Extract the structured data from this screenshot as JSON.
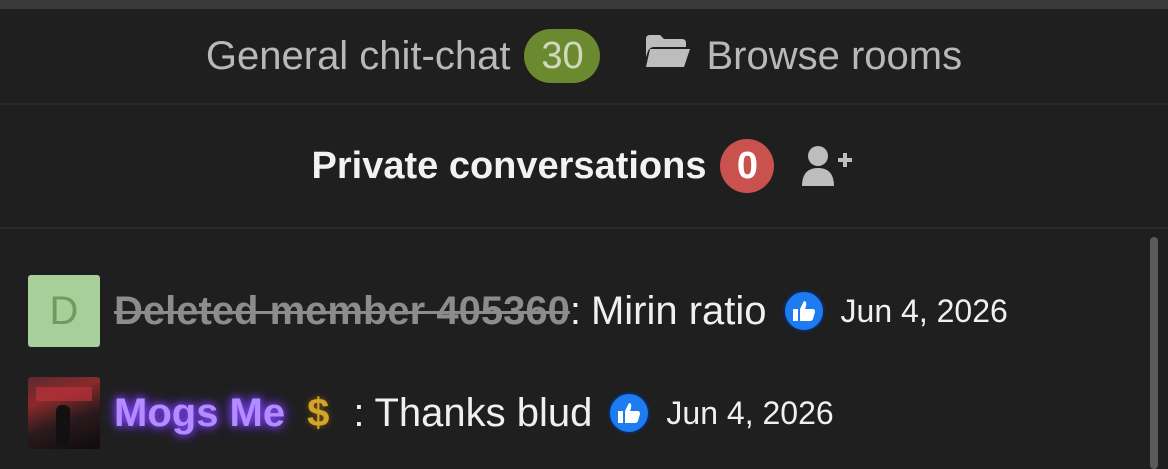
{
  "rooms": {
    "general_label": "General chit-chat",
    "general_count": "30",
    "browse_label": "Browse rooms"
  },
  "private": {
    "label": "Private conversations",
    "count": "0"
  },
  "messages": [
    {
      "avatar_letter": "D",
      "author": "Deleted member 405360",
      "separator": ":",
      "text": "Mirin ratio",
      "date": "Jun 4, 2026"
    },
    {
      "author": "Mogs Me",
      "badge": "$",
      "separator": ":",
      "text": "Thanks blud",
      "date": "Jun 4, 2026"
    }
  ],
  "colors": {
    "count_green": "#6b8a2f",
    "count_red": "#c9524e",
    "like_blue": "#1e7bf0",
    "username_purple": "#b48cff"
  }
}
